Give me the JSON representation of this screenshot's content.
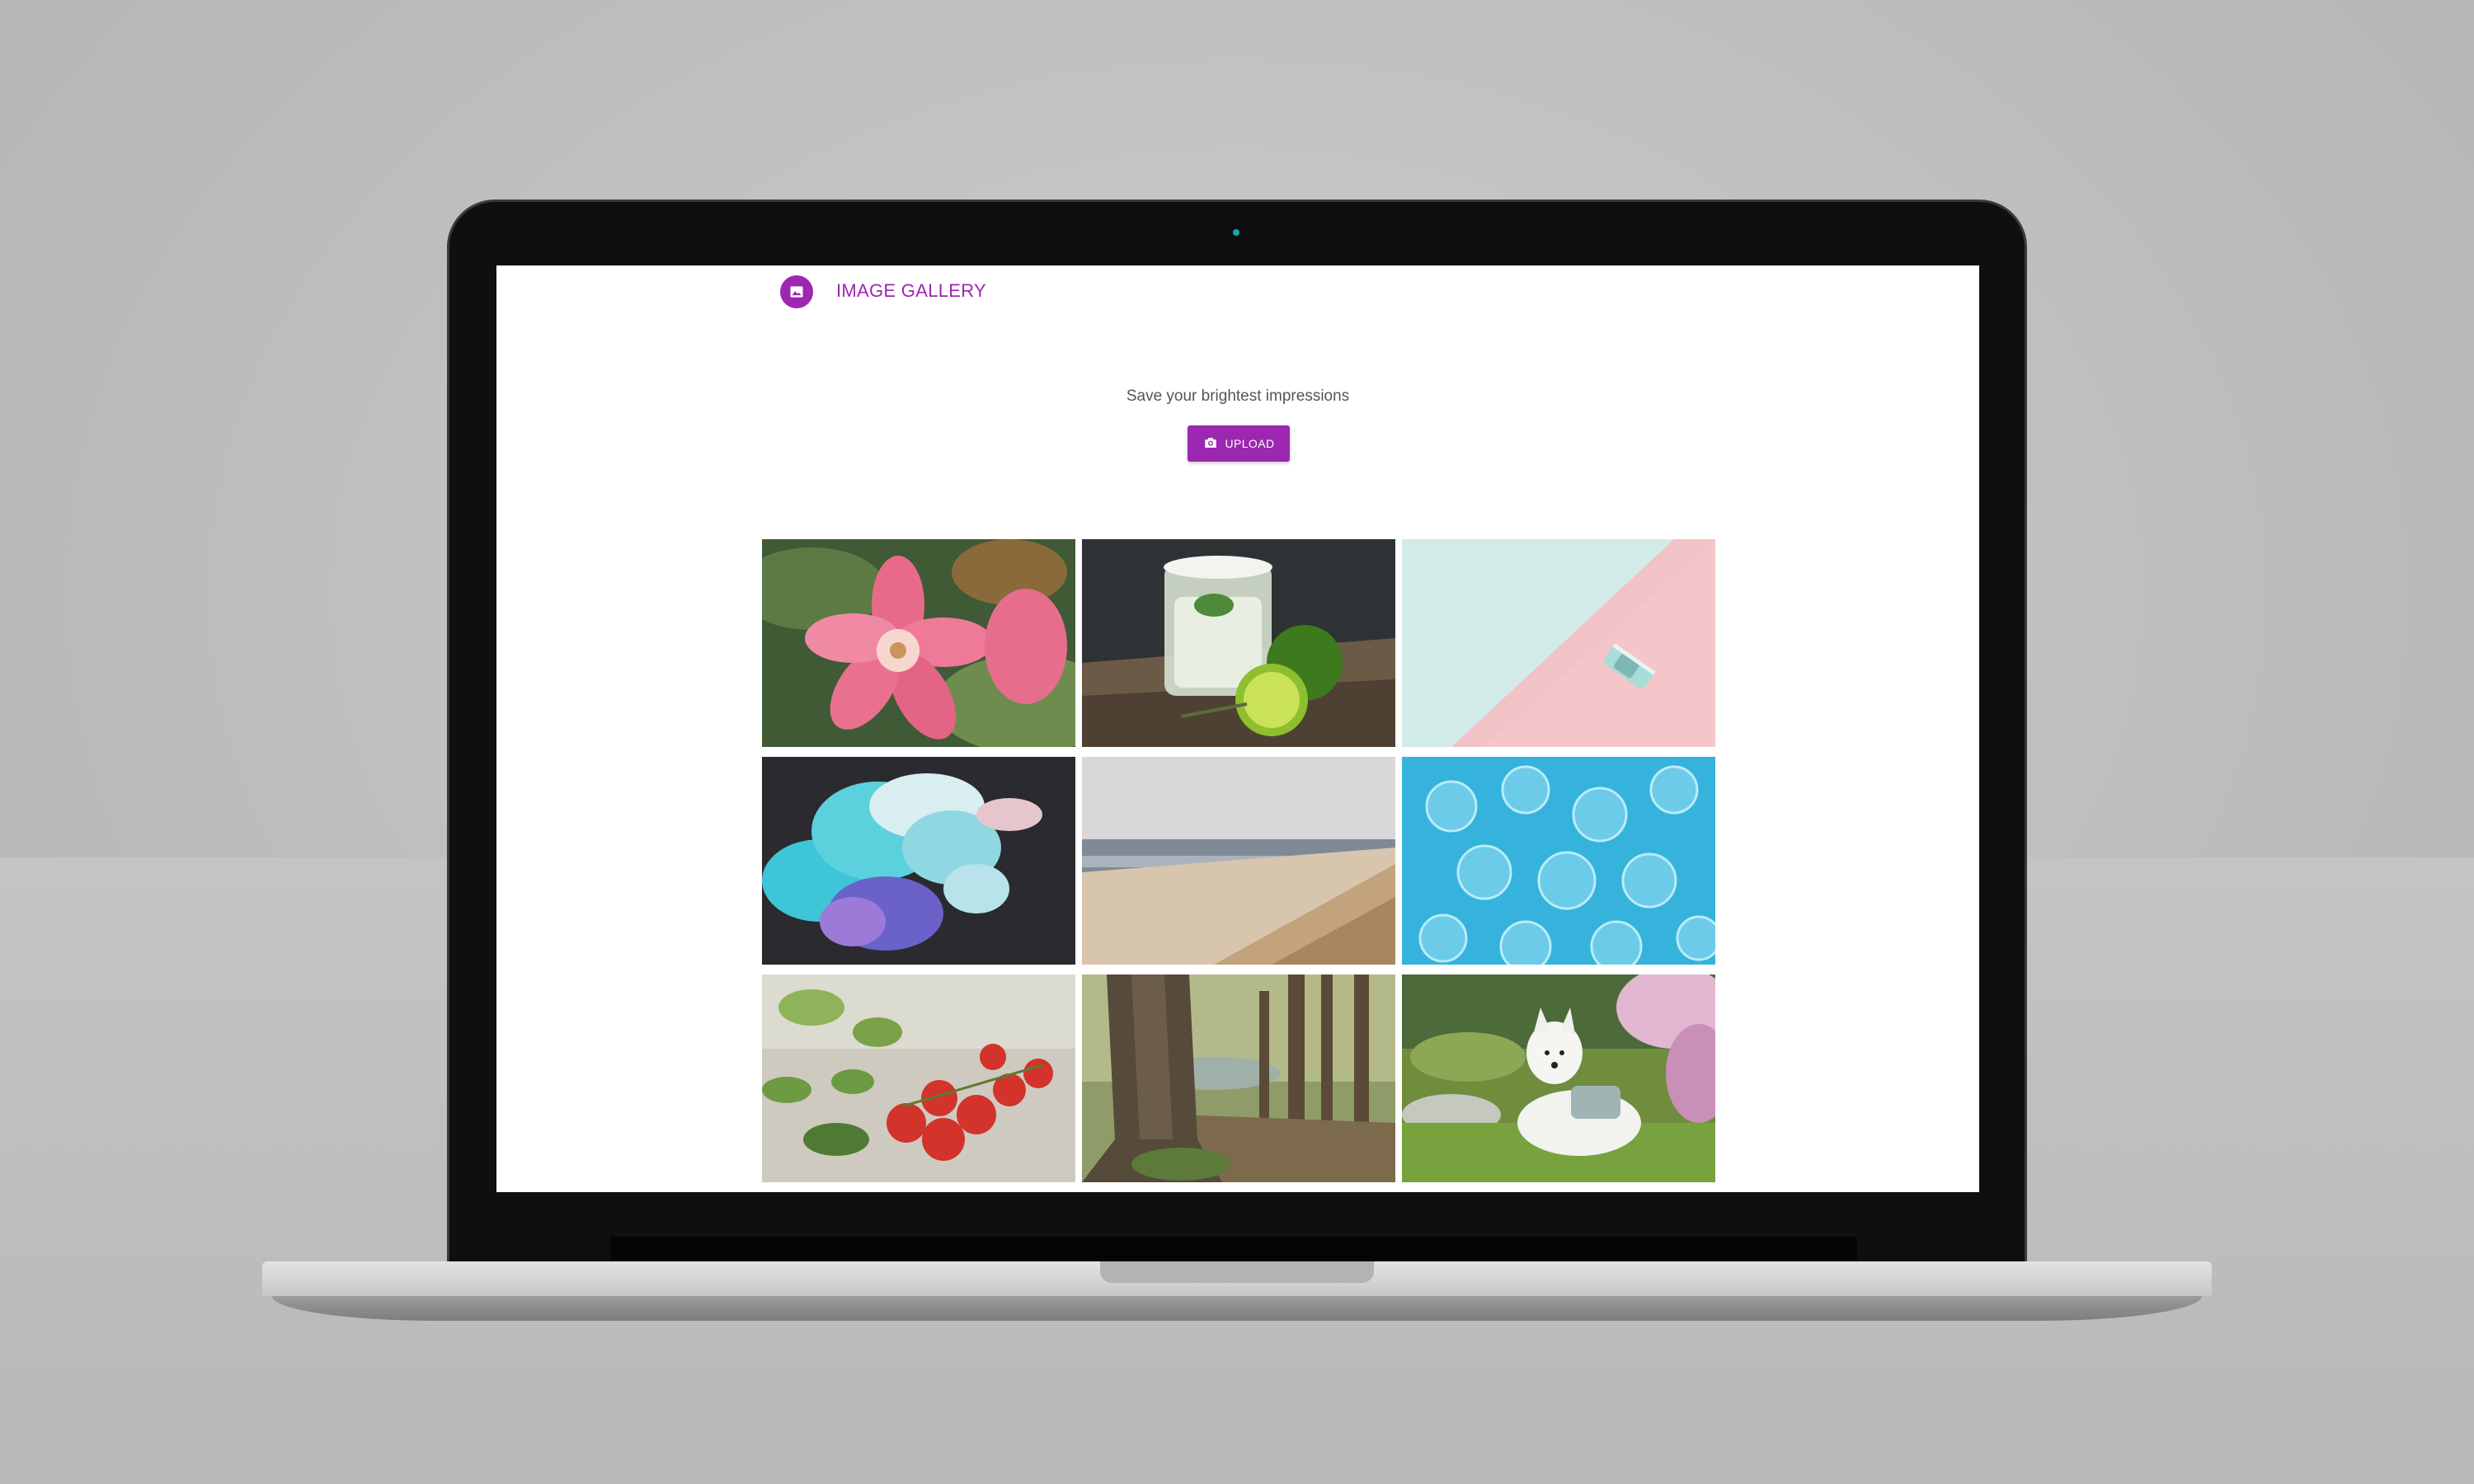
{
  "header": {
    "title": "IMAGE GALLERY",
    "logo_icon": "image-icon"
  },
  "hero": {
    "tagline": "Save your brightest impressions",
    "upload_label": "UPLOAD",
    "upload_icon": "camera-icon"
  },
  "gallery": {
    "images": [
      "pink flower",
      "lime drink",
      "toy car on pastel background",
      "blue ink smoke",
      "beach and dunes",
      "blue bubbles",
      "tomatoes and basil",
      "forest tree",
      "white dog in garden"
    ]
  },
  "colors": {
    "accent": "#9c27b0",
    "background": "#ffffff"
  }
}
